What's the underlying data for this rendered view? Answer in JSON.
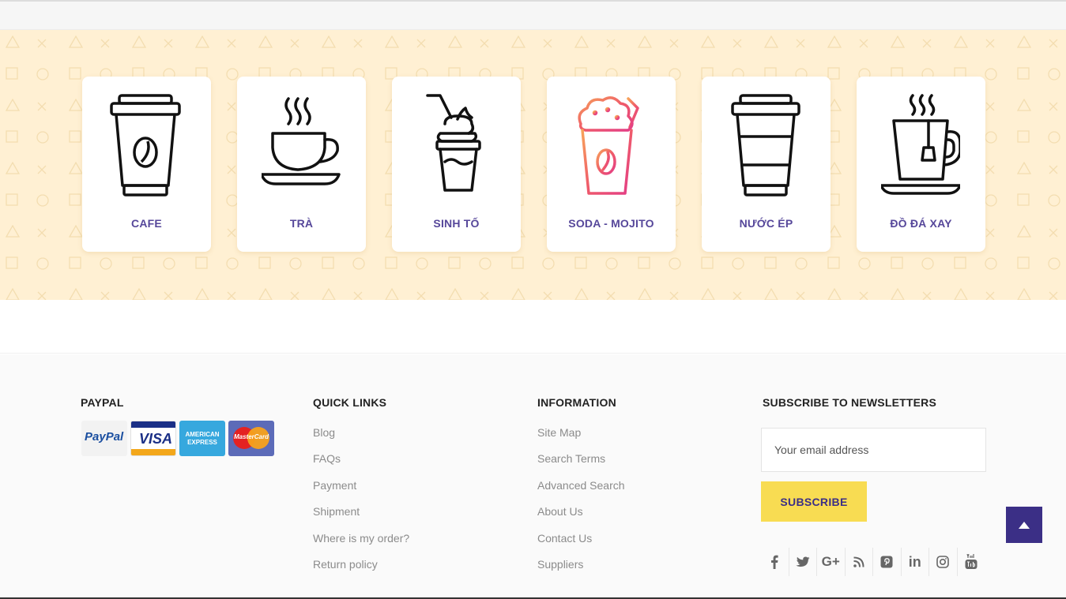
{
  "categories": [
    {
      "label": "CAFE",
      "icon": "coffee-cup-icon"
    },
    {
      "label": "TRÀ",
      "icon": "tea-cup-icon"
    },
    {
      "label": "SINH TỐ",
      "icon": "smoothie-icon"
    },
    {
      "label": "SODA - MOJITO",
      "icon": "soda-cup-icon"
    },
    {
      "label": "NƯỚC ÉP",
      "icon": "juice-cup-icon"
    },
    {
      "label": "ĐỒ ĐÁ XAY",
      "icon": "hot-tea-mug-icon"
    }
  ],
  "footer": {
    "paypal": {
      "title": "PAYPAL",
      "logos": [
        "PayPal",
        "VISA",
        "AMERICAN EXPRESS",
        "MasterCard"
      ]
    },
    "quick_links": {
      "title": "QUICK LINKS",
      "items": [
        "Blog",
        "FAQs",
        "Payment",
        "Shipment",
        "Where is my order?",
        "Return policy"
      ]
    },
    "information": {
      "title": "INFORMATION",
      "items": [
        "Site Map",
        "Search Terms",
        "Advanced Search",
        "About Us",
        "Contact Us",
        "Suppliers"
      ]
    },
    "newsletter": {
      "title": "SUBSCRIBE TO NEWSLETTERS",
      "placeholder": "Your email address",
      "button": "SUBSCRIBE"
    },
    "socials": [
      "f",
      "t",
      "G+",
      "rss",
      "p",
      "in",
      "ig",
      "yt"
    ]
  },
  "colors": {
    "band": "#fff0d3",
    "accent": "#3b2f86",
    "label": "#56479a",
    "subscribe": "#f8dc52"
  }
}
